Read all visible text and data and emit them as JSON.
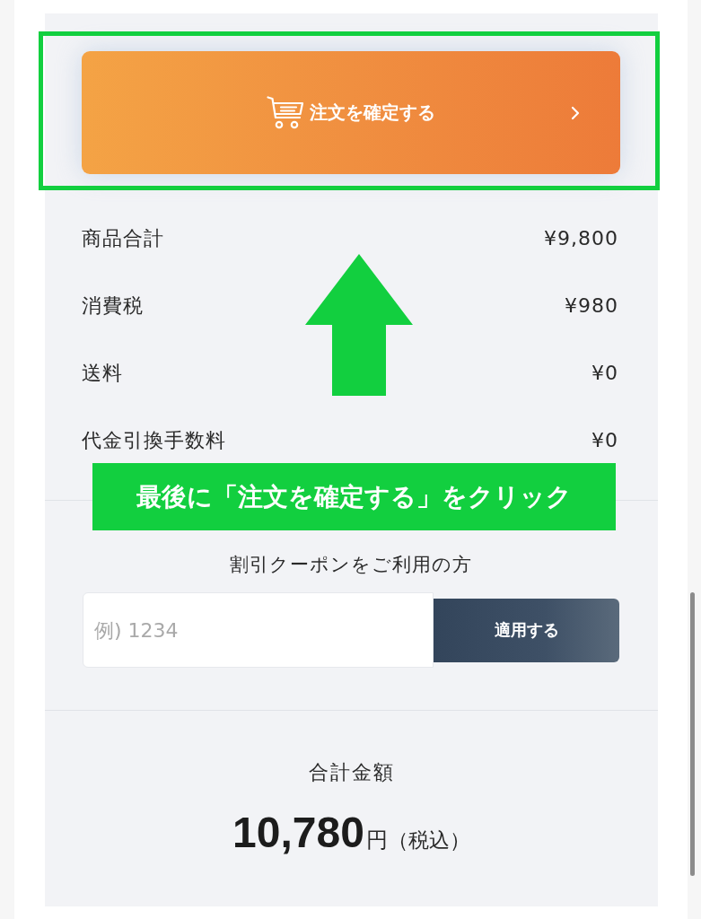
{
  "checkout_button": {
    "label": "注文を確定する"
  },
  "summary": [
    {
      "label": "商品合計",
      "value": "¥9,800"
    },
    {
      "label": "消費税",
      "value": "¥980"
    },
    {
      "label": "送料",
      "value": "¥0"
    },
    {
      "label": "代金引換手数料",
      "value": "¥0"
    }
  ],
  "coupon": {
    "heading": "割引クーポンをご利用の方",
    "placeholder": "例) 1234",
    "button": "適用する"
  },
  "total": {
    "label": "合計金額",
    "amount": "10,780",
    "unit": "円",
    "note": "（税込）"
  },
  "annotation": {
    "text": "最後に「注文を確定する」をクリック"
  }
}
